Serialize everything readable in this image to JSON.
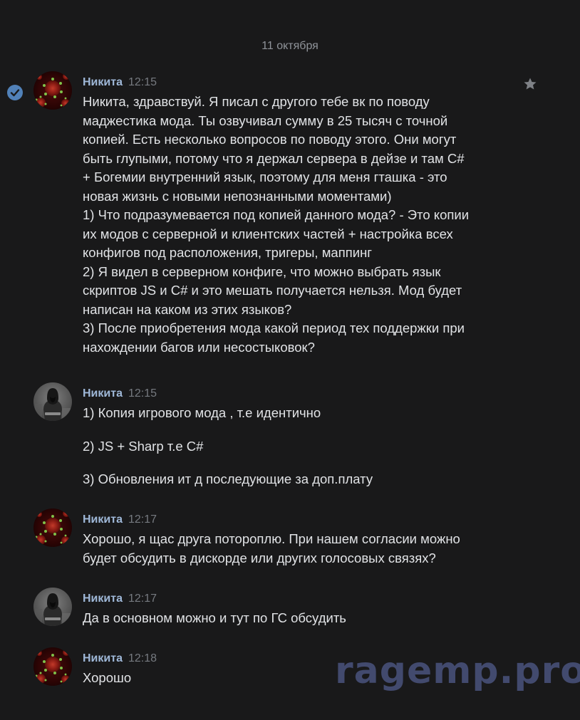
{
  "date_separator": "11 октября",
  "watermark": "ragemp.pro",
  "messages": [
    {
      "author": "Никита",
      "time": "12:15",
      "avatar": "virus-avatar",
      "lines": [
        "Никита, здравствуй. Я писал с другого тебе вк по поводу",
        "маджестика мода. Ты озвучивал сумму в 25 тысяч с точной",
        "копией. Есть несколько вопросов по поводу этого. Они могут",
        "быть глупыми, потому что я держал сервера в дейзе и там C#",
        "+ Богемии внутренний язык, поэтому для меня гташка - это",
        "новая жизнь с новыми непознанными моментами)",
        "1) Что подразумевается под копией данного мода? - Это копии",
        "их модов с серверной и клиентских частей + настройка всех",
        "конфигов под расположения, тригеры, маппинг",
        "2) Я видел в серверном конфиге, что можно выбрать язык",
        "скриптов JS и C# и это мешать получается нельзя. Мод будет",
        "написан на каком из этих языков?",
        "3) После приобретения мода какой период тех поддержки при",
        "нахождении багов или несостыковок?"
      ]
    },
    {
      "author": "Никита",
      "time": "12:15",
      "avatar": "hooded-person-avatar",
      "paragraphs": [
        "1) Копия игрового мода , т.е идентично",
        "2) JS + Sharp т.е C#",
        "3) Обновления ит д последующие за доп.плату"
      ]
    },
    {
      "author": "Никита",
      "time": "12:17",
      "avatar": "virus-avatar",
      "lines": [
        "Хорошо, я щас друга потороплю. При нашем согласии можно",
        "будет обсудить в дискорде или других голосовых связях?"
      ]
    },
    {
      "author": "Никита",
      "time": "12:17",
      "avatar": "hooded-person-avatar",
      "lines": [
        "Да в основном можно и тут по ГС обсудить"
      ]
    },
    {
      "author": "Никита",
      "time": "12:18",
      "avatar": "virus-avatar",
      "lines": [
        "Хорошо"
      ]
    }
  ]
}
